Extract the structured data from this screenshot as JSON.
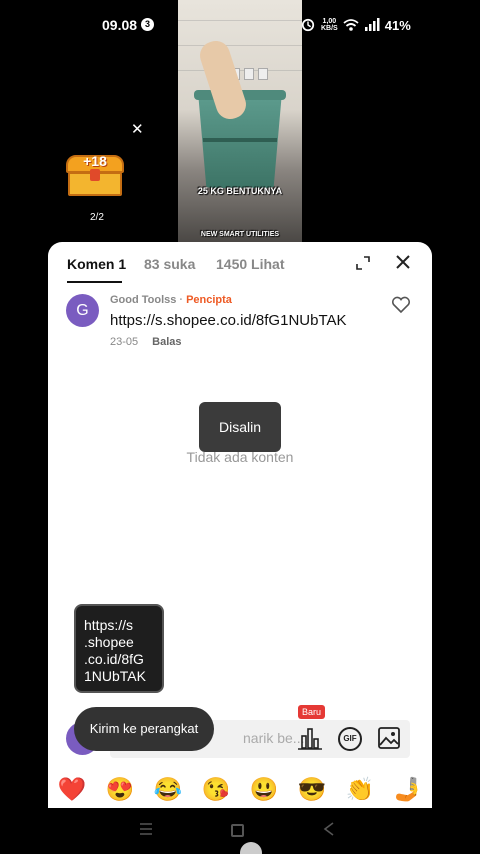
{
  "status_bar": {
    "time": "09.08",
    "notification_count": "3",
    "net_speed_value": "1,00",
    "net_speed_unit": "KB/S",
    "battery": "41%"
  },
  "video": {
    "caption_main": "25 KG BENTUKNYA",
    "caption_brand": "NEW SMART UTILITIES"
  },
  "overlay": {
    "chest_label": "+18",
    "page_counter": "2/2"
  },
  "comments_sheet": {
    "tabs": [
      {
        "label": "Komen 1"
      },
      {
        "label": "83 suka"
      },
      {
        "label": "1450 Lihat"
      }
    ],
    "comment": {
      "avatar_letter": "G",
      "author": "Good Toolss",
      "author_badge": "Pencipta",
      "text": "https://s.shopee.co.id/8fG1NUbTAK",
      "date": "23-05",
      "reply_label": "Balas"
    },
    "toast": "Disalin",
    "empty_text": "Tidak ada konten",
    "input": {
      "placeholder": "narik be...",
      "new_badge": "Baru",
      "gif_label": "GIF"
    },
    "emojis": [
      "❤️",
      "😍",
      "😂",
      "😘",
      "😃",
      "😎",
      "👏",
      "🤳"
    ]
  },
  "clipboard_popup": {
    "lines": [
      "https://s",
      ".shopee",
      ".co.id/8fG",
      "1NUbTAK"
    ]
  },
  "send_to_device_label": "Kirim ke perangkat"
}
